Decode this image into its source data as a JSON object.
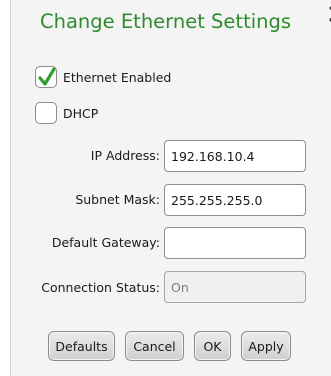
{
  "dialog": {
    "title": "Change Ethernet Settings"
  },
  "checkboxes": {
    "ethernet_enabled": {
      "label": "Ethernet Enabled",
      "checked": true
    },
    "dhcp": {
      "label": "DHCP",
      "checked": false
    }
  },
  "fields": {
    "ip_address": {
      "label": "IP Address:",
      "value": "192.168.10.4"
    },
    "subnet_mask": {
      "label": "Subnet Mask:",
      "value": "255.255.255.0"
    },
    "default_gateway": {
      "label": "Default Gateway:",
      "value": ""
    },
    "connection_status": {
      "label": "Connection Status:",
      "value": "On"
    }
  },
  "buttons": {
    "defaults": "Defaults",
    "cancel": "Cancel",
    "ok": "OK",
    "apply": "Apply"
  },
  "colors": {
    "title": "#2e8b2e",
    "checkmark": "#2aa02a"
  }
}
